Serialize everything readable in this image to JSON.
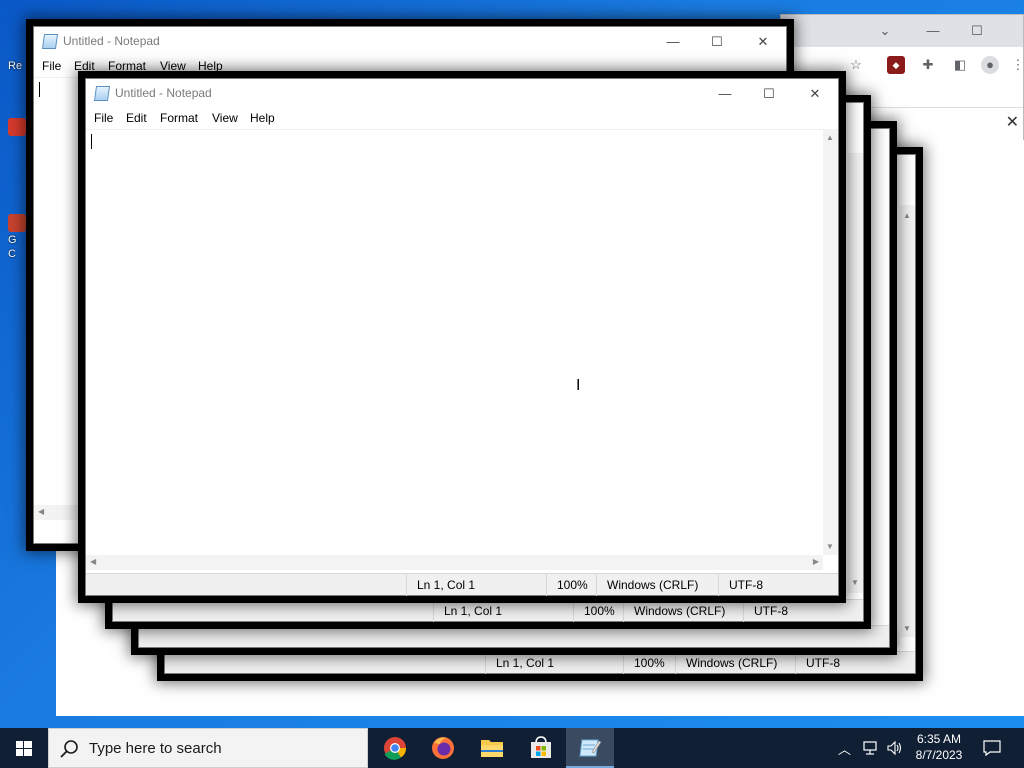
{
  "notepad": {
    "title": "Untitled - Notepad",
    "menu": [
      "File",
      "Edit",
      "Format",
      "View",
      "Help"
    ],
    "status": {
      "position": "Ln 1, Col 1",
      "zoom": "100%",
      "line_ending": "Windows (CRLF)",
      "encoding": "UTF-8"
    }
  },
  "desktop": {
    "icon1_label": "Re",
    "icon2_label": "G",
    "icon2_sub": "C"
  },
  "taskbar": {
    "search_placeholder": "Type here to search",
    "time": "6:35 AM",
    "date": "8/7/2023"
  },
  "colors": {
    "taskbar": "#101f33",
    "desktop": "#1a7be0"
  }
}
